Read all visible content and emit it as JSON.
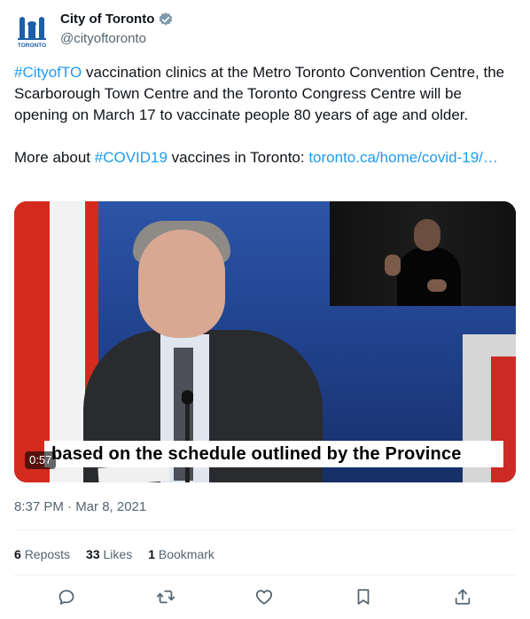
{
  "account": {
    "display_name": "City of Toronto",
    "handle": "@cityoftoronto",
    "logo_text": "TORONTO"
  },
  "tweet": {
    "p1_hashtag": "#CityofTO",
    "p1_text": " vaccination clinics at the Metro Toronto Convention Centre, the Scarborough Town Centre and the Toronto Congress Centre will be opening on March 17 to vaccinate people 80 years of age and older.",
    "p2_prefix": "More about ",
    "p2_hashtag": "#COVID19",
    "p2_mid": " vaccines in Toronto: ",
    "p2_link": "toronto.ca/home/covid-19/…"
  },
  "media": {
    "caption": "based on the schedule outlined by the Province",
    "duration": "0:57"
  },
  "timestamp": "8:37 PM · Mar 8, 2021",
  "stats": {
    "reposts_count": "6",
    "reposts_label": "Reposts",
    "likes_count": "33",
    "likes_label": "Likes",
    "bookmarks_count": "1",
    "bookmarks_label": "Bookmark"
  },
  "icons": {
    "reply": "reply-icon",
    "repost": "repost-icon",
    "like": "like-icon",
    "bookmark": "bookmark-icon",
    "share": "share-icon",
    "verified": "verified-badge-icon"
  },
  "colors": {
    "link": "#1d9bf0",
    "secondary_text": "#536471",
    "verified_badge": "#829aab",
    "logo_blue": "#1b5fa8"
  }
}
